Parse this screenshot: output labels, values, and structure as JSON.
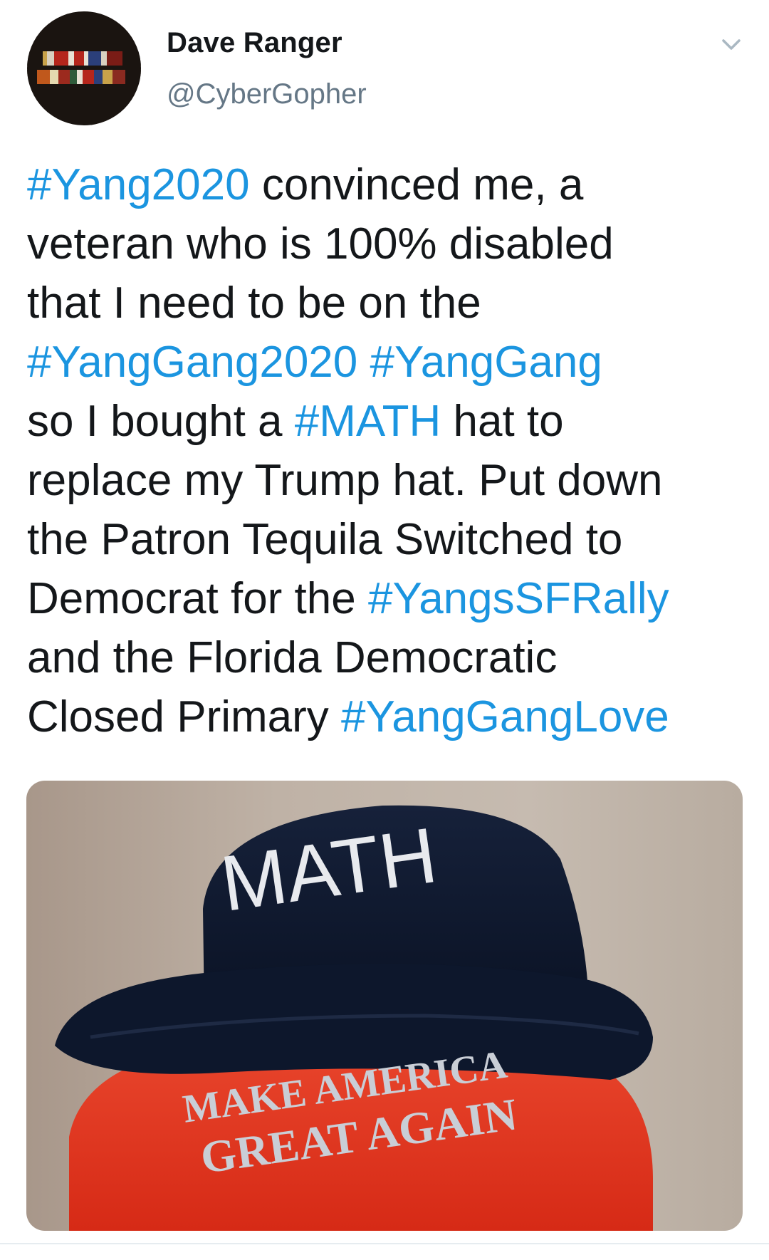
{
  "tweet": {
    "author_name": "Dave Ranger",
    "author_handle": "@CyberGopher",
    "lines": [
      [
        {
          "text": "#Yang2020",
          "tag": true
        },
        {
          "text": " convinced me, a",
          "tag": false
        }
      ],
      [
        {
          "text": "veteran who is 100% disabled",
          "tag": false
        }
      ],
      [
        {
          "text": "that I need to be on the",
          "tag": false
        }
      ],
      [
        {
          "text": "#YangGang2020",
          "tag": true
        },
        {
          "text": " ",
          "tag": false
        },
        {
          "text": "#YangGang",
          "tag": true
        }
      ],
      [
        {
          "text": "so I bought a ",
          "tag": false
        },
        {
          "text": "#MATH",
          "tag": true
        },
        {
          "text": " hat to",
          "tag": false
        }
      ],
      [
        {
          "text": "replace my Trump hat. Put down",
          "tag": false
        }
      ],
      [
        {
          "text": "the Patron Tequila Switched to",
          "tag": false
        }
      ],
      [
        {
          "text": "Democrat for the ",
          "tag": false
        },
        {
          "text": "#YangsSFRally",
          "tag": true
        }
      ],
      [
        {
          "text": "and the Florida Democratic",
          "tag": false
        }
      ],
      [
        {
          "text": "Closed Primary ",
          "tag": false
        },
        {
          "text": "#YangGangLove",
          "tag": true
        }
      ]
    ],
    "photo": {
      "hat_top_text": "MATH",
      "hat_line1": "MAKE AMERICA",
      "hat_line2": "GREAT AGAIN"
    }
  },
  "icons": {
    "avatar": "military-ribbons-avatar",
    "menu": "chevron-down-icon"
  },
  "colors": {
    "hashtag": "#1b95e0",
    "text": "#14171a",
    "secondary": "#657786",
    "hat_navy": "#0f1a2e",
    "hat_red": "#e0321e"
  }
}
